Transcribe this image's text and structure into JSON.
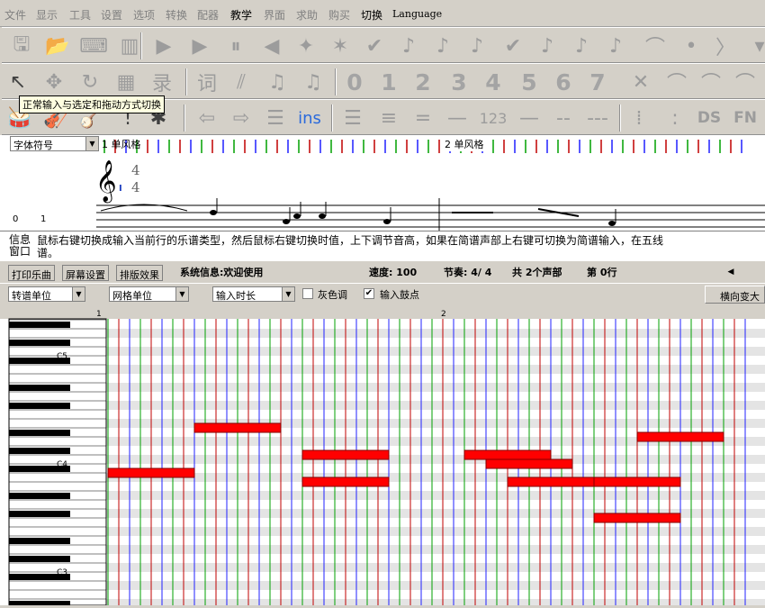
{
  "menu": [
    "文件",
    "显示",
    "工具",
    "设置",
    "选项",
    "转换",
    "配器",
    "教学",
    "界面",
    "求助",
    "购买",
    "切换",
    "Language"
  ],
  "menu_enabled": [
    false,
    false,
    false,
    false,
    false,
    false,
    false,
    true,
    false,
    false,
    false,
    true,
    true
  ],
  "toolbar1": {
    "icons": [
      "save-icon",
      "open-icon",
      "keyboard-icon",
      "piano-icon",
      "play-icon",
      "play-step-icon",
      "pause-icon",
      "back-icon",
      "butterfly-icon",
      "star-icon",
      "check-icon",
      "note-up-icon",
      "note-up2-icon",
      "note-up3-icon",
      "abc-check-icon",
      "note-up4-icon",
      "note-up5-icon",
      "note-up6-icon",
      "fermata-icon",
      "dot-icon",
      "chevron-right-icon",
      "dropdown-icon"
    ]
  },
  "toolbar2": {
    "numbers": [
      "0",
      "1",
      "2",
      "3",
      "4",
      "5",
      "6",
      "7"
    ],
    "record_glyph": "录",
    "tie_glyph": "词"
  },
  "toolbar3": {
    "ins": "ins",
    "nums": "123",
    "ds": "DS",
    "fn": "FN"
  },
  "tooltip": "正常输入与选定和拖动方式切换",
  "score": {
    "font_combo": "字体符号",
    "measure1_label": "1 单风格",
    "measure2_label": "2 单风格",
    "time_sig_top": "4",
    "time_sig_bottom": "4",
    "row_num_0": "0",
    "row_num_1": "1",
    "cursor_label": "I"
  },
  "info": {
    "label": "信息\n窗口",
    "text_line1": "鼠标右键切换成输入当前行的乐谱类型，然后鼠标右键切换时值，上下调节音高，如果在简谱声部上右键可切换为简谱输入，在五线",
    "text_line2": "谱。"
  },
  "tabs": [
    "打印乐曲",
    "屏幕设置",
    "排版效果"
  ],
  "status": {
    "system": "系统信息:欢迎使用",
    "speed": "速度: 100",
    "beat": "节奏: 4/ 4",
    "parts": "共 2个声部",
    "row": "第 0行"
  },
  "piano_controls": {
    "combo1": "转谱单位",
    "combo2": "网格单位",
    "combo3": "输入时长",
    "check_gray": "灰色调",
    "check_gray_checked": false,
    "check_drum": "输入鼓点",
    "check_drum_checked": true,
    "btn_wide": "横向变大"
  },
  "roll": {
    "measure_labels": [
      "1",
      "2"
    ],
    "key_labels": [
      "C5",
      "C4",
      "C3"
    ],
    "notes": [
      {
        "row": 17,
        "start": 0,
        "len": 8
      },
      {
        "row": 18,
        "start": 18,
        "len": 8
      },
      {
        "row": 15,
        "start": 18,
        "len": 8
      },
      {
        "row": 15,
        "start": 33,
        "len": 8
      },
      {
        "row": 16,
        "start": 35,
        "len": 8
      },
      {
        "row": 12,
        "start": 8,
        "len": 8
      },
      {
        "row": 13,
        "start": 49,
        "len": 8
      },
      {
        "row": 18,
        "start": 37,
        "len": 8
      },
      {
        "row": 18,
        "start": 45,
        "len": 8
      },
      {
        "row": 22,
        "start": 45,
        "len": 8
      }
    ]
  },
  "colors": {
    "note": "#ff0000",
    "grid_red": "#c00000",
    "grid_green": "#00a000",
    "grid_blue": "#2020ff",
    "bg": "#d4d0c8"
  }
}
